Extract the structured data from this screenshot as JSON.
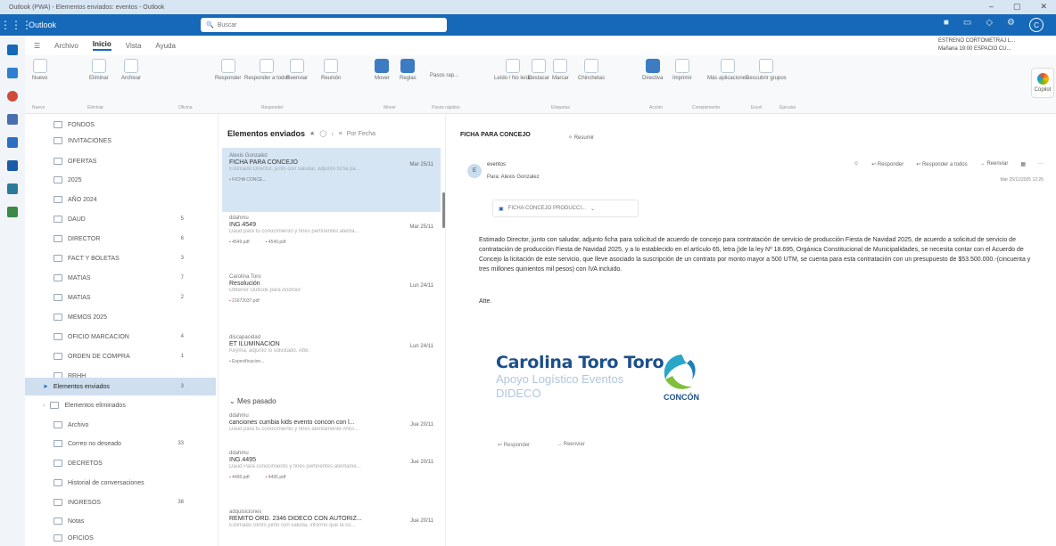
{
  "window": {
    "title": "Outlook (PWA) - Elementos enviados: eventos - Outlook"
  },
  "topbar": {
    "app_name": "Outlook",
    "search_placeholder": "Buscar",
    "avatar_initial": "C"
  },
  "menu": {
    "items": [
      "Archivo",
      "Inicio",
      "Vista",
      "Ayuda"
    ],
    "active": "Inicio"
  },
  "notice": {
    "line1": "ESTRENO CORTOMETRAJ L...",
    "line2": "Mañana 19:00 ESPACIO CU..."
  },
  "ribbon": {
    "buttons": [
      {
        "label": "Nuevo"
      },
      {
        "label": "Eliminar"
      },
      {
        "label": "Archivar"
      },
      {
        "label": "Responder"
      },
      {
        "label": "Responder a todos"
      },
      {
        "label": "Reenviar"
      },
      {
        "label": "Reunión"
      },
      {
        "label": "Mover"
      },
      {
        "label": "Reglas"
      },
      {
        "label": "Pasos rap..."
      },
      {
        "label": "Leído / No leído"
      },
      {
        "label": "Destacar"
      },
      {
        "label": "Marcar"
      },
      {
        "label": "Chinchetas"
      },
      {
        "label": "Directiva"
      },
      {
        "label": "Imprimir"
      },
      {
        "label": "Más aplicaciones"
      },
      {
        "label": "Descubrir grupos"
      }
    ],
    "groups": [
      "Nuevo",
      "Eliminar",
      "Oficina",
      "Responder",
      "Mover",
      "Pasos rápidos",
      "Etiquetas",
      "Acción",
      "Complemento",
      "Excel",
      "Ejecutar"
    ],
    "copilot_label": "Copilot"
  },
  "folders": [
    {
      "name": "FONDOS",
      "count": ""
    },
    {
      "name": "INVITACIONES",
      "count": ""
    },
    {
      "name": "OFERTAS",
      "count": ""
    },
    {
      "name": "2025",
      "count": ""
    },
    {
      "name": "AÑO 2024",
      "count": ""
    },
    {
      "name": "DAUD",
      "count": "5"
    },
    {
      "name": "DIRECTOR",
      "count": "6"
    },
    {
      "name": "FACT Y BOLETAS",
      "count": "3"
    },
    {
      "name": "MATIAS",
      "count": "7"
    },
    {
      "name": "MATIAS",
      "count": "2"
    },
    {
      "name": "MEMOS 2025",
      "count": ""
    },
    {
      "name": "OFICIO MARCACION",
      "count": "4"
    },
    {
      "name": "ORDEN DE COMPRA",
      "count": "1"
    },
    {
      "name": "RRHH",
      "count": ""
    },
    {
      "name": "Elementos enviados",
      "count": "3"
    },
    {
      "name": "Elementos eliminados",
      "count": ""
    },
    {
      "name": "Archivo",
      "count": ""
    },
    {
      "name": "Correo no deseado",
      "count": "33"
    },
    {
      "name": "DECRETOS",
      "count": ""
    },
    {
      "name": "Historial de conversaciones",
      "count": ""
    },
    {
      "name": "INGRESOS",
      "count": "38"
    },
    {
      "name": "Notas",
      "count": ""
    },
    {
      "name": "OFICIOS",
      "count": ""
    }
  ],
  "message_list": {
    "title": "Elementos enviados",
    "sort_label": "Por Fecha",
    "group_label": "Mes pasado",
    "messages": [
      {
        "from": "Alexis Gonzalez",
        "subject": "FICHA PARA CONCEJO",
        "date": "Mar 25/11",
        "preview": "Estimado Director, junto con saludar, adjunto ficha pa...",
        "attachments": [
          "FICHA CONCE..."
        ]
      },
      {
        "from": "ddahmu",
        "subject": "ING.4549",
        "date": "Mar 25/11",
        "preview": "Daud para tu conocimiento y fines pertinentes atenta...",
        "attachments": [
          "4549.pdf",
          "4549.pdf"
        ]
      },
      {
        "from": "Carolina Toro",
        "subject": "Resolución",
        "date": "Lun 24/11",
        "preview": "Obtener Outlook para Android",
        "attachments": [
          "21672037.pdf"
        ]
      },
      {
        "from": "discapacidad",
        "subject": "ET ILUMINACION",
        "date": "Lun 24/11",
        "preview": "Keyma, adjunto lo solicitado. Atte.",
        "attachments": [
          "Especificacion..."
        ]
      },
      {
        "from": "ddahmu",
        "subject": "canciones cumbia kids evento concon con l...",
        "date": "Jue 20/11",
        "preview": "Daud para tu conocimiento y fines atentamente ANG...",
        "attachments": []
      },
      {
        "from": "ddahmu",
        "subject": "ING.4495",
        "date": "Jue 20/11",
        "preview": "Daud Para conocimiento y fines pertinentes atentame...",
        "attachments": [
          "4495.pdf",
          "4495.pdf"
        ]
      },
      {
        "from": "adquisiciones",
        "subject": "REMITO ORD. 2346 DIDECO CON AUTORIZ...",
        "date": "Jue 20/11",
        "preview": "Estimado Vents junto con saluda, informo que la co...",
        "attachments": []
      }
    ]
  },
  "reading": {
    "subject": "FICHA PARA CONCEJO",
    "summarize": "Resumir",
    "sender_initial": "E",
    "from": "eventos",
    "to": "Para: Alexis Gonzalez",
    "actions": [
      "Responder",
      "Responder a todos",
      "Reenviar"
    ],
    "date": "Mar 25/11/2025 12:26",
    "attachment": "FICHA CONCEJO PRODUCCI...",
    "body": "Estimado Director, junto con saludar, adjunto ficha para solicitud de acuerdo de concejo para contratación de servicio de producción Fiesta de Navidad 2025, de acuerdo a solicitud de servicio de contratación de producción Fiesta de Navidad 2025, y a lo establecido en el artículo 65, letra j)de la ley Nº 18.695, Orgánica Constitucional de Municipalidades, se necesita contar con el Acuerdo de Concejo la licitación de este servicio, que lleve asociado la suscripción de un contrato por monto mayor a 500 UTM, se cuenta para esta contratación con un presupuesto de $53.500.000.-(cincuenta y tres millones quinientos mil pesos) con IVA incluido.",
    "closing": "Atte.",
    "signature": {
      "name": "Carolina Toro Toro",
      "role": "Apoyo Logístico Eventos",
      "dept": "DIDECO",
      "logo_text": "CONCÓN"
    },
    "footer_actions": [
      "Responder",
      "Reenviar"
    ]
  }
}
